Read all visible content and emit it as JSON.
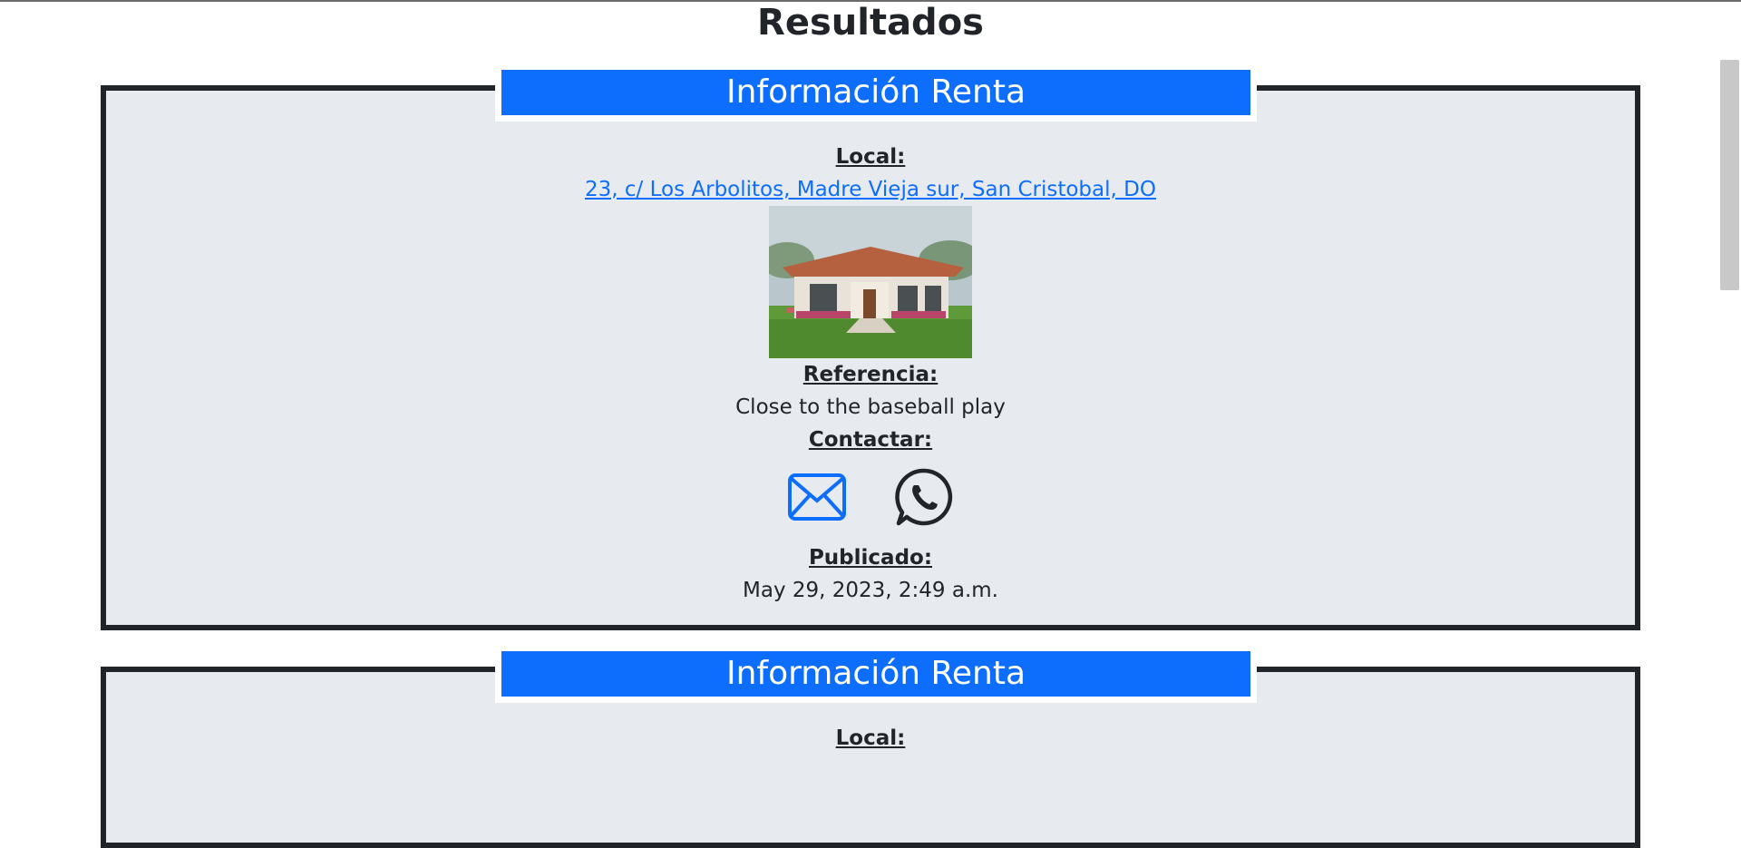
{
  "page": {
    "title": "Resultados"
  },
  "listings": [
    {
      "header": "Información Renta",
      "local_label": "Local:",
      "address": "23, c/ Los Arbolitos, Madre Vieja sur, San Cristobal, DO",
      "reference_label": "Referencia:",
      "reference": "Close to the baseball play",
      "contact_label": "Contactar:",
      "published_label": "Publicado:",
      "published": "May 29, 2023, 2:49 a.m."
    },
    {
      "header": "Información Renta",
      "local_label": "Local:"
    }
  ],
  "icons": {
    "email": "envelope-icon",
    "whatsapp": "whatsapp-icon"
  },
  "colors": {
    "accent": "#0d6efd",
    "card_bg": "#e7eaee",
    "border": "#212529"
  }
}
